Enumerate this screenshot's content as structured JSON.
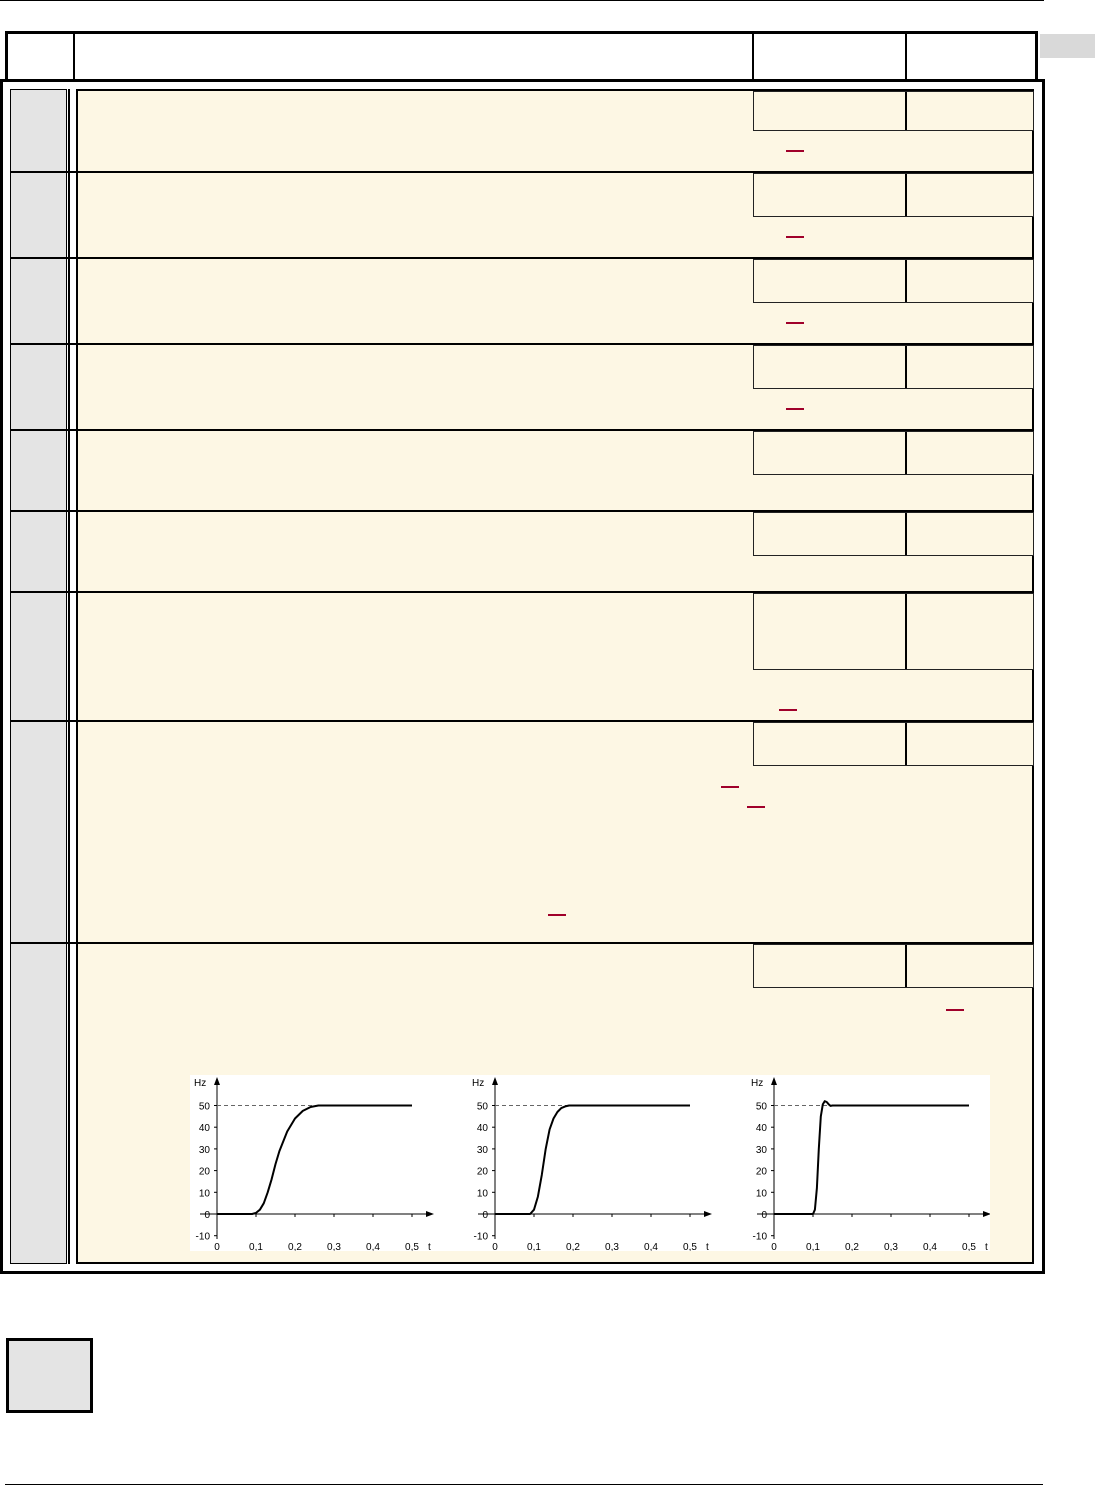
{
  "charts": {
    "y_axis_label": "Hz",
    "x_axis_label": "t",
    "y_ticks": [
      "50",
      "40",
      "30",
      "20",
      "10",
      "0",
      "-10"
    ],
    "x_ticks": [
      "0",
      "0,1",
      "0,2",
      "0,3",
      "0,4",
      "0,5"
    ]
  },
  "chart_data": [
    {
      "type": "line",
      "xlabel": "t",
      "ylabel": "Hz",
      "xlim": [
        0,
        0.5
      ],
      "ylim": [
        -10,
        55
      ],
      "reference_line_y": 50,
      "x": [
        0,
        0.09,
        0.1,
        0.11,
        0.12,
        0.13,
        0.14,
        0.15,
        0.16,
        0.18,
        0.2,
        0.22,
        0.24,
        0.26,
        0.28,
        0.3,
        0.5
      ],
      "y": [
        0,
        0,
        0.5,
        2,
        5,
        10,
        16,
        23,
        29,
        38,
        44,
        47.5,
        49.3,
        50,
        50,
        50,
        50
      ]
    },
    {
      "type": "line",
      "xlabel": "t",
      "ylabel": "Hz",
      "xlim": [
        0,
        0.5
      ],
      "ylim": [
        -10,
        55
      ],
      "reference_line_y": 50,
      "x": [
        0,
        0.09,
        0.1,
        0.11,
        0.12,
        0.13,
        0.14,
        0.15,
        0.16,
        0.17,
        0.18,
        0.19,
        0.2,
        0.5
      ],
      "y": [
        0,
        0,
        2,
        8,
        18,
        30,
        39,
        44,
        47,
        48.8,
        49.6,
        50,
        50,
        50
      ]
    },
    {
      "type": "line",
      "xlabel": "t",
      "ylabel": "Hz",
      "xlim": [
        0,
        0.5
      ],
      "ylim": [
        -10,
        55
      ],
      "reference_line_y": 50,
      "x": [
        0,
        0.1,
        0.105,
        0.11,
        0.115,
        0.12,
        0.125,
        0.13,
        0.135,
        0.14,
        0.145,
        0.15,
        0.16,
        0.5
      ],
      "y": [
        0,
        0,
        2,
        12,
        30,
        45,
        50.5,
        52,
        51.6,
        50.6,
        49.8,
        50,
        50,
        50
      ]
    }
  ]
}
